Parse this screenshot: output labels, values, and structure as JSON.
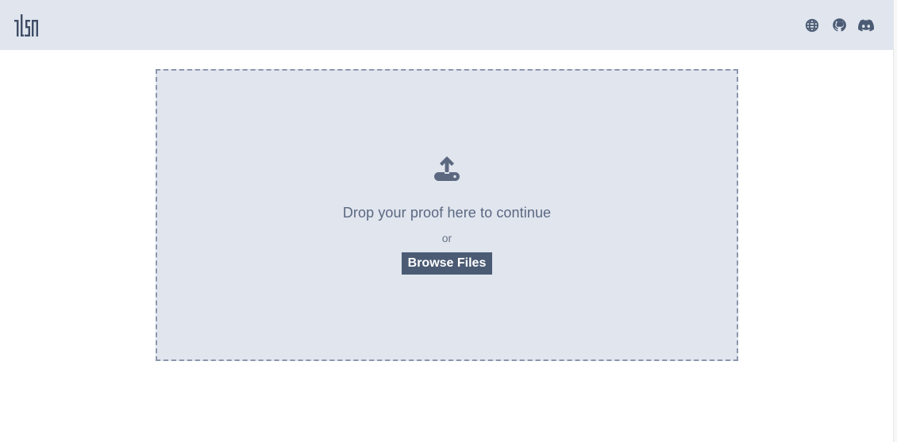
{
  "header": {
    "logo_text": "TLSN",
    "icons": [
      {
        "name": "globe-icon"
      },
      {
        "name": "github-icon"
      },
      {
        "name": "discord-icon"
      }
    ]
  },
  "dropzone": {
    "instruction": "Drop your proof here to continue",
    "separator": "or",
    "browse_label": "Browse Files",
    "icon": "upload-icon"
  },
  "colors": {
    "header_bg": "#e0e5ee",
    "dropzone_bg": "#e0e5ee",
    "accent": "#4b5b74",
    "icon": "#5b6880"
  }
}
